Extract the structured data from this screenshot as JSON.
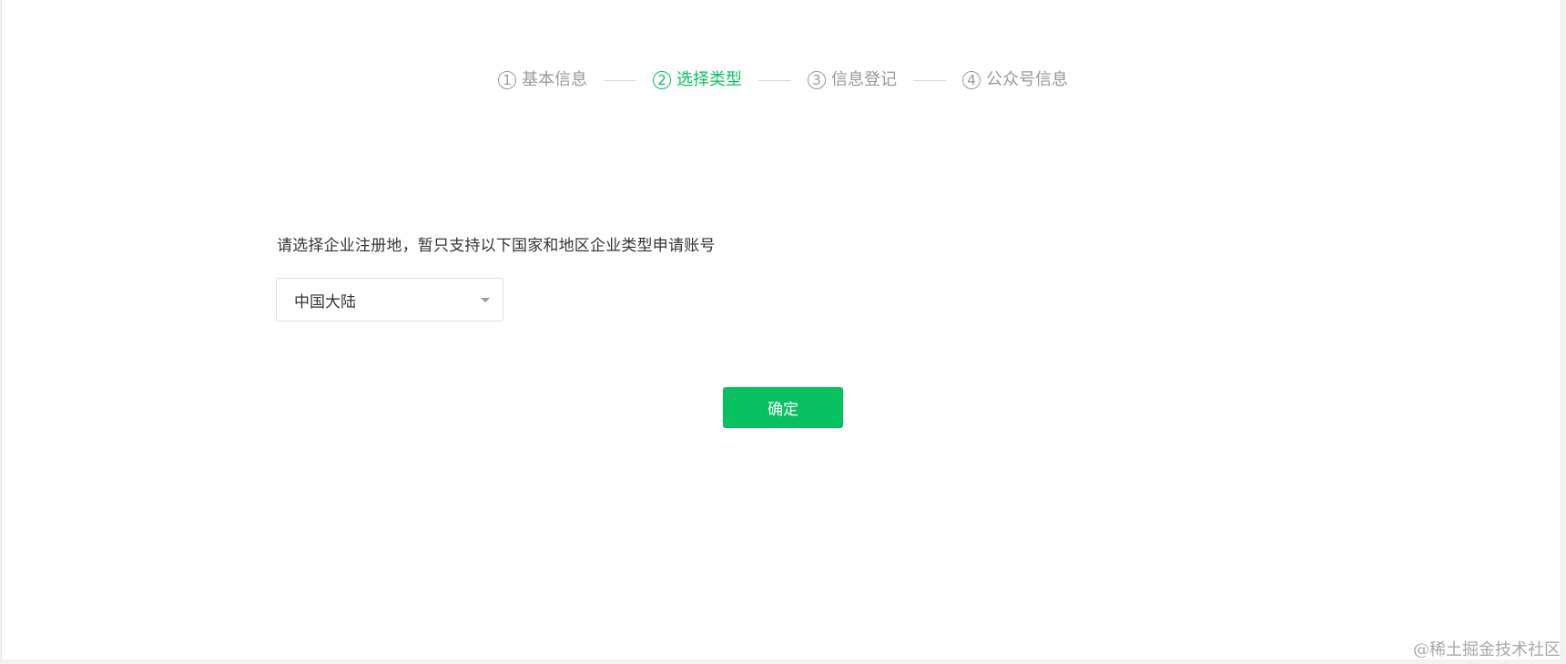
{
  "stepper": {
    "steps": [
      {
        "num": "1",
        "label": "基本信息",
        "state": "inactive"
      },
      {
        "num": "2",
        "label": "选择类型",
        "state": "active"
      },
      {
        "num": "3",
        "label": "信息登记",
        "state": "inactive"
      },
      {
        "num": "4",
        "label": "公众号信息",
        "state": "inactive"
      }
    ]
  },
  "region": {
    "prompt": "请选择企业注册地，暂只支持以下国家和地区企业类型申请账号",
    "selected": "中国大陆"
  },
  "actions": {
    "confirm_label": "确定"
  },
  "watermark": "@稀土掘金技术社区",
  "colors": {
    "accent": "#07c160",
    "inactive_text": "#9a9a9a",
    "body_text": "#353535"
  },
  "icons": {
    "select_caret": "chevron-down-icon"
  }
}
